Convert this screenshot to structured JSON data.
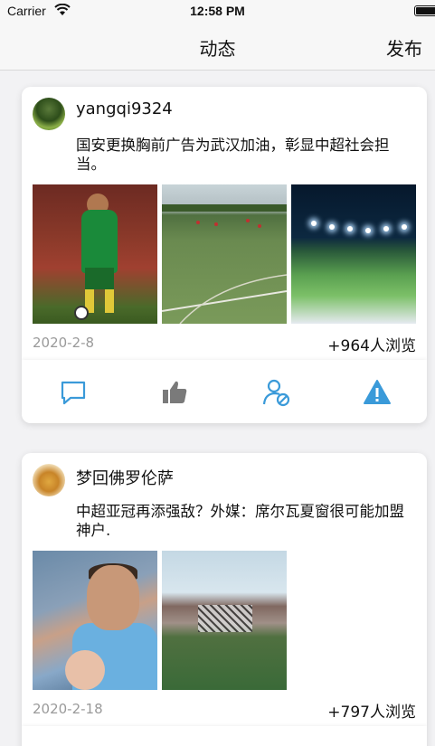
{
  "status_bar": {
    "carrier": "Carrier",
    "time": "12:58 PM",
    "wifi_icon": "wifi-icon",
    "battery_icon": "battery-icon"
  },
  "nav": {
    "title": "动态",
    "publish_label": "发布"
  },
  "posts": [
    {
      "username": "yangqi9324",
      "text": "国安更换胸前广告为武汉加油，彰显中超社会担当。",
      "date": "2020-2-8",
      "views": "+964人浏览",
      "photos": [
        "player-photo",
        "training-field-photo",
        "night-pitch-photo"
      ],
      "actions": [
        "comment-icon",
        "thumbs-up-icon",
        "block-user-icon",
        "warning-icon"
      ]
    },
    {
      "username": "梦回佛罗伦萨",
      "text": "中超亚冠再添强敌？外媒：席尔瓦夏窗很可能加盟神户.",
      "date": "2020-2-18",
      "views": "+797人浏览",
      "photos": [
        "player-with-child-photo",
        "stadium-pitch-photo"
      ]
    }
  ],
  "colors": {
    "accent": "#3a9ad9",
    "icon_gray": "#7a7a7a",
    "date_gray": "#9a9a9a",
    "background": "#f2f2f4"
  }
}
